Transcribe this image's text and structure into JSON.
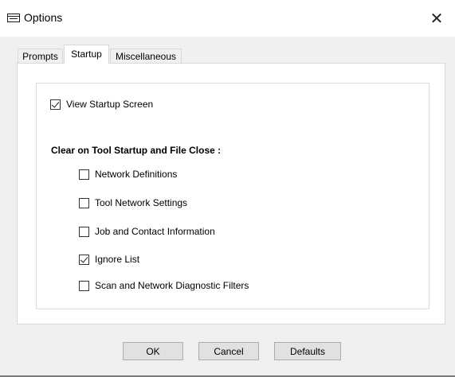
{
  "window": {
    "title": "Options",
    "icon": "window-icon",
    "close_glyph": "✕"
  },
  "tabs": [
    {
      "label": "Prompts",
      "active": false
    },
    {
      "label": "Startup",
      "active": true
    },
    {
      "label": "Miscellaneous",
      "active": false
    }
  ],
  "startup": {
    "view_startup_screen": {
      "label": "View Startup Screen",
      "checked": true
    },
    "clear_heading": "Clear on Tool Startup and File Close :",
    "clear_options": [
      {
        "label": "Network Definitions",
        "checked": false
      },
      {
        "label": "Tool Network Settings",
        "checked": false
      },
      {
        "label": "Job and Contact Information",
        "checked": false
      },
      {
        "label": "Ignore List",
        "checked": true
      },
      {
        "label": "Scan and Network Diagnostic Filters",
        "checked": false
      }
    ]
  },
  "buttons": {
    "ok": "OK",
    "cancel": "Cancel",
    "defaults": "Defaults"
  }
}
